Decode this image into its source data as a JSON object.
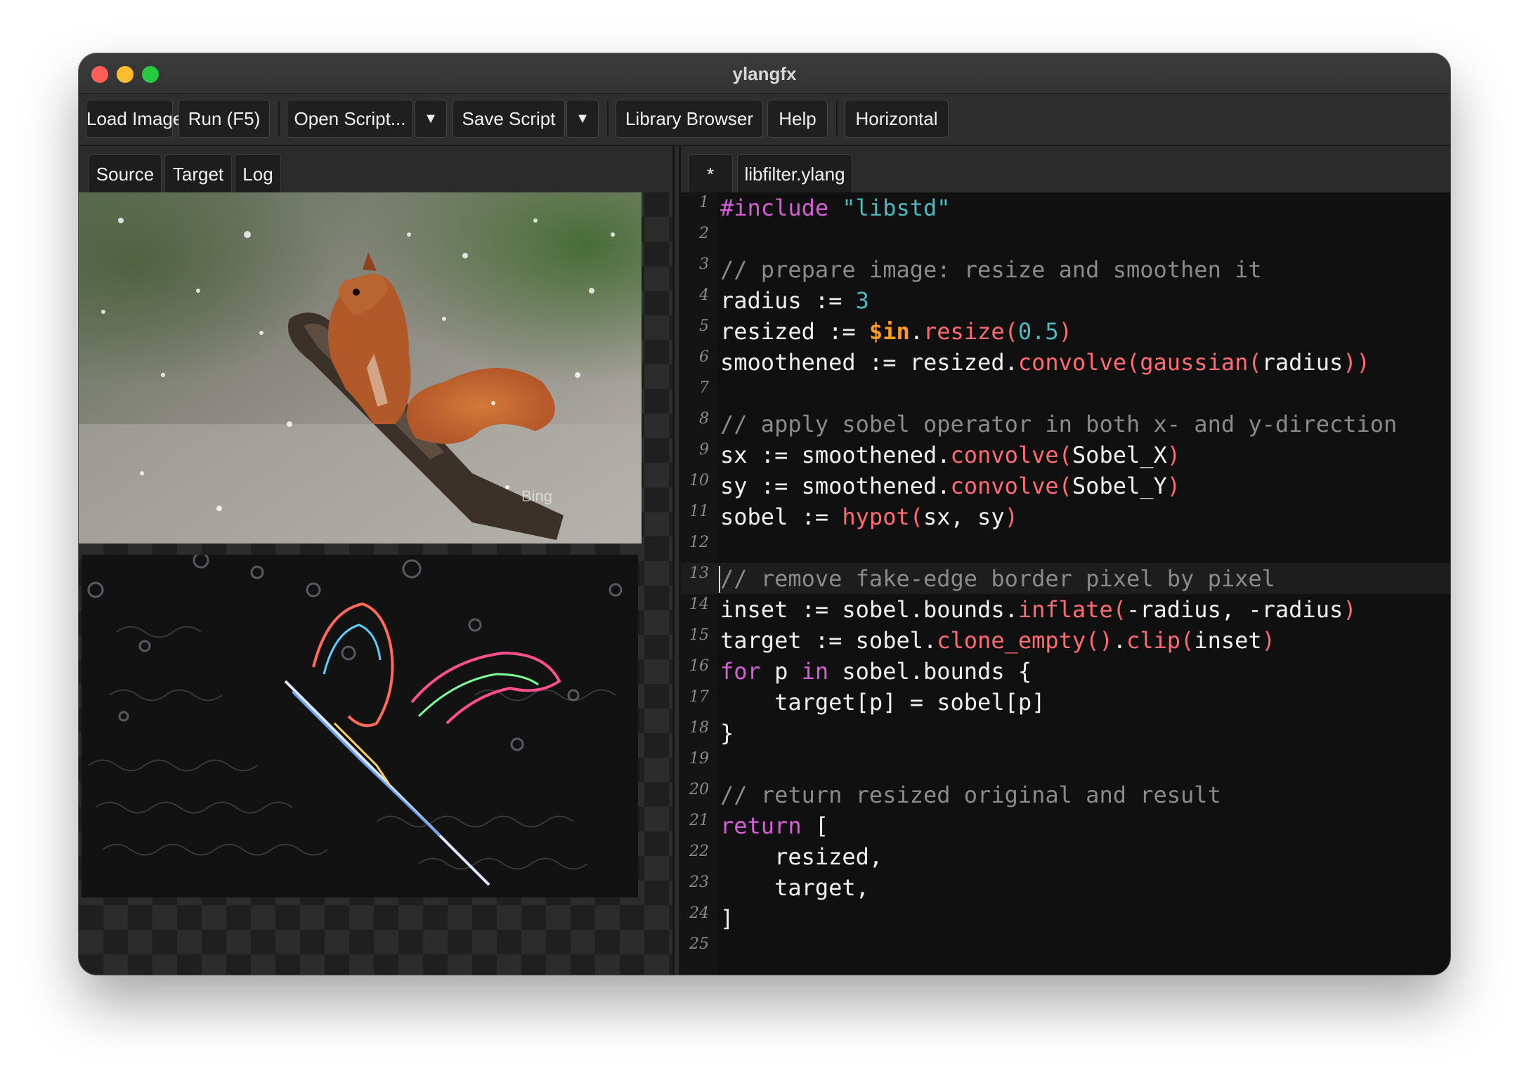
{
  "window": {
    "title": "ylangfx"
  },
  "toolbar": {
    "load_image": "Load Image...",
    "run": "Run (F5)",
    "open_script": "Open Script...",
    "save_script": "Save Script",
    "library_browser": "Library Browser",
    "help": "Help",
    "orientation": "Horizontal"
  },
  "left_tabs": [
    "Source",
    "Target",
    "Log"
  ],
  "right_tabs": [
    "*",
    "libfilter.ylang"
  ],
  "images": {
    "watermark": "Bing"
  },
  "editor": {
    "current_line": 13,
    "lines": [
      [
        [
          "keyword",
          "#include "
        ],
        [
          "string",
          "\"libstd\""
        ]
      ],
      [],
      [
        [
          "comment",
          "// prepare image: resize and smoothen it"
        ]
      ],
      [
        [
          "plain",
          "radius := "
        ],
        [
          "number",
          "3"
        ]
      ],
      [
        [
          "plain",
          "resized := "
        ],
        [
          "special",
          "$in"
        ],
        [
          "plain",
          "."
        ],
        [
          "method",
          "resize("
        ],
        [
          "number",
          "0.5"
        ],
        [
          "method",
          ")"
        ]
      ],
      [
        [
          "plain",
          "smoothened := resized."
        ],
        [
          "method",
          "convolve(gaussian("
        ],
        [
          "plain",
          "radius"
        ],
        [
          "method",
          "))"
        ]
      ],
      [],
      [
        [
          "comment",
          "// apply sobel operator in both x- and y-direction"
        ]
      ],
      [
        [
          "plain",
          "sx := smoothened."
        ],
        [
          "method",
          "convolve("
        ],
        [
          "plain",
          "Sobel_X"
        ],
        [
          "method",
          ")"
        ]
      ],
      [
        [
          "plain",
          "sy := smoothened."
        ],
        [
          "method",
          "convolve("
        ],
        [
          "plain",
          "Sobel_Y"
        ],
        [
          "method",
          ")"
        ]
      ],
      [
        [
          "plain",
          "sobel := "
        ],
        [
          "method",
          "hypot("
        ],
        [
          "plain",
          "sx, sy"
        ],
        [
          "method",
          ")"
        ]
      ],
      [],
      [
        [
          "comment",
          "// remove fake-edge border pixel by pixel"
        ]
      ],
      [
        [
          "plain",
          "inset := sobel.bounds."
        ],
        [
          "method",
          "inflate("
        ],
        [
          "plain",
          "-radius, -radius"
        ],
        [
          "method",
          ")"
        ]
      ],
      [
        [
          "plain",
          "target := sobel."
        ],
        [
          "method",
          "clone_empty()"
        ],
        [
          "plain",
          "."
        ],
        [
          "method",
          "clip("
        ],
        [
          "plain",
          "inset"
        ],
        [
          "method",
          ")"
        ]
      ],
      [
        [
          "keyword",
          "for"
        ],
        [
          "plain",
          " p "
        ],
        [
          "keyword",
          "in"
        ],
        [
          "plain",
          " sobel.bounds {"
        ]
      ],
      [
        [
          "plain",
          "    target[p] = sobel[p]"
        ]
      ],
      [
        [
          "plain",
          "}"
        ]
      ],
      [],
      [
        [
          "comment",
          "// return resized original and result"
        ]
      ],
      [
        [
          "keyword",
          "return"
        ],
        [
          "plain",
          " ["
        ]
      ],
      [
        [
          "plain",
          "    resized,"
        ]
      ],
      [
        [
          "plain",
          "    target,"
        ]
      ],
      [
        [
          "plain",
          "]"
        ]
      ],
      []
    ]
  },
  "colors": {
    "keyword": "#d65fd6",
    "string": "#4fb9bf",
    "comment": "#8a8a8a",
    "method": "#ff6b73",
    "special": "#ff9a1f"
  }
}
